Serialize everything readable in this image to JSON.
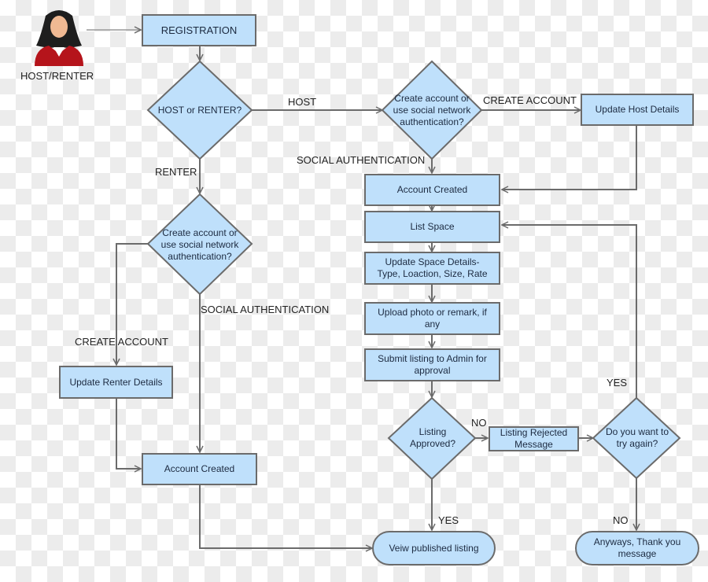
{
  "actor": {
    "label": "HOST/RENTER",
    "icon": "user-avatar-icon"
  },
  "colors": {
    "fill": "#bfe0fb",
    "stroke": "#6b6b6b",
    "text": "#1c2a40"
  },
  "nodes": {
    "registration": "REGISTRATION",
    "host_or_renter": "HOST or RENTER?",
    "host_auth_decision": "Create account or use social network authentication?",
    "update_host_details": "Update Host Details",
    "host_account_created": "Account Created",
    "list_space": "List Space",
    "update_space_details": "Update Space Details- Type, Loaction, Size, Rate",
    "upload_photo": "Upload photo or remark, if any",
    "submit_listing": "Submit listing to Admin for approval",
    "listing_approved": "Listing Approved?",
    "listing_rejected": "Listing Rejected Message",
    "try_again": "Do you want to try again?",
    "view_published": "Veiw published listing",
    "thank_you": "Anyways, Thank you message",
    "renter_auth_decision": "Create account or use social network authentication?",
    "update_renter_details": "Update Renter Details",
    "renter_account_created": "Account Created"
  },
  "edge_labels": {
    "host": "HOST",
    "renter": "RENTER",
    "host_create_account": "CREATE ACCOUNT",
    "host_social_auth": "SOCIAL AUTHENTICATION",
    "renter_create_account": "CREATE ACCOUNT",
    "renter_social_auth": "SOCIAL AUTHENTICATION",
    "approved_no": "NO",
    "approved_yes": "YES",
    "retry_yes": "YES",
    "retry_no": "NO"
  }
}
